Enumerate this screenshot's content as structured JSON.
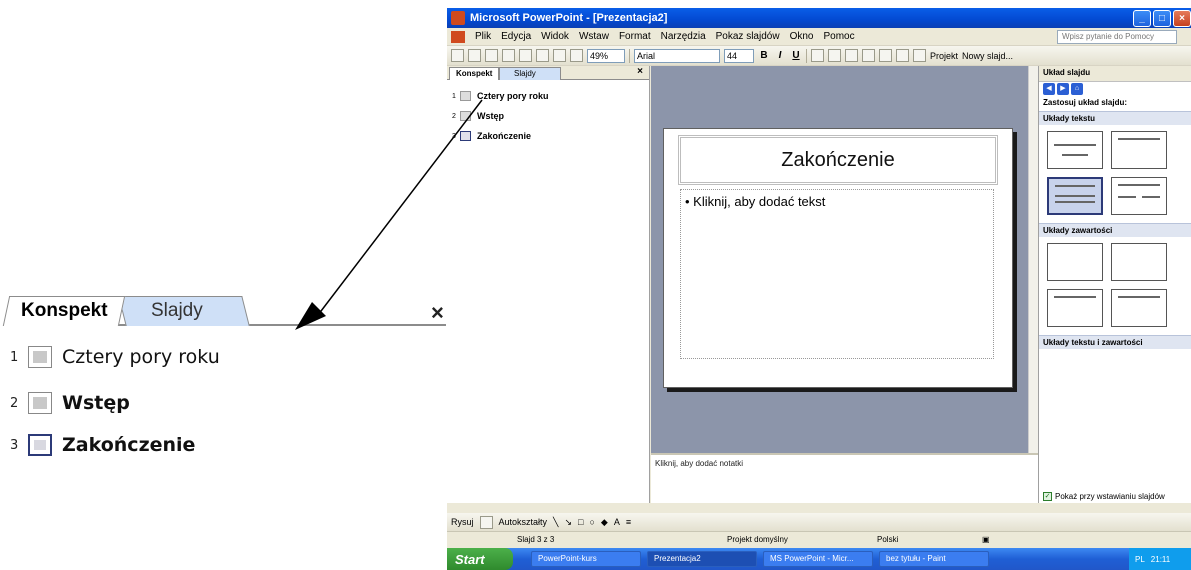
{
  "zoom": {
    "tabs": [
      "Konspekt",
      "Slajdy"
    ],
    "close": "×",
    "items": [
      {
        "num": "1",
        "label": "Cztery pory roku"
      },
      {
        "num": "2",
        "label": "Wstęp"
      },
      {
        "num": "3",
        "label": "Zakończenie"
      }
    ]
  },
  "window": {
    "title": "Microsoft PowerPoint - [Prezentacja2]",
    "menu": [
      "Plik",
      "Edycja",
      "Widok",
      "Wstaw",
      "Format",
      "Narzędzia",
      "Pokaz slajdów",
      "Okno",
      "Pomoc"
    ],
    "help_placeholder": "Wpisz pytanie do Pomocy",
    "zoom": "49%",
    "font": "Arial",
    "font_size": "44",
    "toolbar_bold": "B",
    "toolbar_italic": "I",
    "toolbar_underline": "U",
    "projekt": "Projekt",
    "nowy_slajd": "Nowy slajd..."
  },
  "outline": {
    "tabs": [
      "Konspekt",
      "Slajdy"
    ],
    "close": "×",
    "items": [
      {
        "num": "1",
        "label": "Cztery pory roku"
      },
      {
        "num": "2",
        "label": "Wstęp"
      },
      {
        "num": "3",
        "label": "Zakończenie"
      }
    ]
  },
  "slide": {
    "title": "Zakończenie",
    "body": "• Kliknij, aby dodać tekst"
  },
  "notes": "Kliknij, aby dodać notatki",
  "taskpane": {
    "title": "Układ slajdu",
    "apply": "Zastosuj układ slajdu:",
    "sections": [
      "Układy tekstu",
      "Układy zawartości",
      "Układy tekstu i zawartości"
    ],
    "show_on_insert": "Pokaż przy wstawianiu slajdów"
  },
  "drawbar": {
    "rysuj": "Rysuj",
    "autoksztalty": "Autokształty"
  },
  "status": {
    "slide": "Slajd 3 z 3",
    "design": "Projekt domyślny",
    "lang": "Polski"
  },
  "taskbar": {
    "start": "Start",
    "tasks": [
      "PowerPoint-kurs",
      "Prezentacja2",
      "MS PowerPoint - Micr...",
      "bez tytułu - Paint"
    ],
    "lang": "PL",
    "clock": "21:11"
  }
}
